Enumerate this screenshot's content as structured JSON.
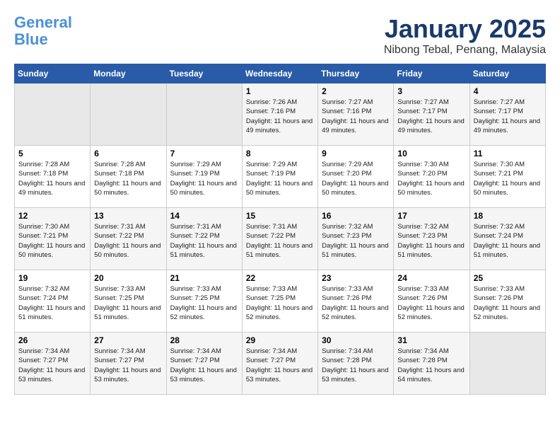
{
  "header": {
    "logo_line1": "General",
    "logo_line2": "Blue",
    "title": "January 2025",
    "location": "Nibong Tebal, Penang, Malaysia"
  },
  "days_of_week": [
    "Sunday",
    "Monday",
    "Tuesday",
    "Wednesday",
    "Thursday",
    "Friday",
    "Saturday"
  ],
  "weeks": [
    [
      {
        "day": "",
        "sunrise": "",
        "sunset": "",
        "daylight": "",
        "empty": true
      },
      {
        "day": "",
        "sunrise": "",
        "sunset": "",
        "daylight": "",
        "empty": true
      },
      {
        "day": "",
        "sunrise": "",
        "sunset": "",
        "daylight": "",
        "empty": true
      },
      {
        "day": "1",
        "sunrise": "Sunrise: 7:26 AM",
        "sunset": "Sunset: 7:16 PM",
        "daylight": "Daylight: 11 hours and 49 minutes.",
        "empty": false
      },
      {
        "day": "2",
        "sunrise": "Sunrise: 7:27 AM",
        "sunset": "Sunset: 7:16 PM",
        "daylight": "Daylight: 11 hours and 49 minutes.",
        "empty": false
      },
      {
        "day": "3",
        "sunrise": "Sunrise: 7:27 AM",
        "sunset": "Sunset: 7:17 PM",
        "daylight": "Daylight: 11 hours and 49 minutes.",
        "empty": false
      },
      {
        "day": "4",
        "sunrise": "Sunrise: 7:27 AM",
        "sunset": "Sunset: 7:17 PM",
        "daylight": "Daylight: 11 hours and 49 minutes.",
        "empty": false
      }
    ],
    [
      {
        "day": "5",
        "sunrise": "Sunrise: 7:28 AM",
        "sunset": "Sunset: 7:18 PM",
        "daylight": "Daylight: 11 hours and 49 minutes.",
        "empty": false
      },
      {
        "day": "6",
        "sunrise": "Sunrise: 7:28 AM",
        "sunset": "Sunset: 7:18 PM",
        "daylight": "Daylight: 11 hours and 50 minutes.",
        "empty": false
      },
      {
        "day": "7",
        "sunrise": "Sunrise: 7:29 AM",
        "sunset": "Sunset: 7:19 PM",
        "daylight": "Daylight: 11 hours and 50 minutes.",
        "empty": false
      },
      {
        "day": "8",
        "sunrise": "Sunrise: 7:29 AM",
        "sunset": "Sunset: 7:19 PM",
        "daylight": "Daylight: 11 hours and 50 minutes.",
        "empty": false
      },
      {
        "day": "9",
        "sunrise": "Sunrise: 7:29 AM",
        "sunset": "Sunset: 7:20 PM",
        "daylight": "Daylight: 11 hours and 50 minutes.",
        "empty": false
      },
      {
        "day": "10",
        "sunrise": "Sunrise: 7:30 AM",
        "sunset": "Sunset: 7:20 PM",
        "daylight": "Daylight: 11 hours and 50 minutes.",
        "empty": false
      },
      {
        "day": "11",
        "sunrise": "Sunrise: 7:30 AM",
        "sunset": "Sunset: 7:21 PM",
        "daylight": "Daylight: 11 hours and 50 minutes.",
        "empty": false
      }
    ],
    [
      {
        "day": "12",
        "sunrise": "Sunrise: 7:30 AM",
        "sunset": "Sunset: 7:21 PM",
        "daylight": "Daylight: 11 hours and 50 minutes.",
        "empty": false
      },
      {
        "day": "13",
        "sunrise": "Sunrise: 7:31 AM",
        "sunset": "Sunset: 7:22 PM",
        "daylight": "Daylight: 11 hours and 50 minutes.",
        "empty": false
      },
      {
        "day": "14",
        "sunrise": "Sunrise: 7:31 AM",
        "sunset": "Sunset: 7:22 PM",
        "daylight": "Daylight: 11 hours and 51 minutes.",
        "empty": false
      },
      {
        "day": "15",
        "sunrise": "Sunrise: 7:31 AM",
        "sunset": "Sunset: 7:22 PM",
        "daylight": "Daylight: 11 hours and 51 minutes.",
        "empty": false
      },
      {
        "day": "16",
        "sunrise": "Sunrise: 7:32 AM",
        "sunset": "Sunset: 7:23 PM",
        "daylight": "Daylight: 11 hours and 51 minutes.",
        "empty": false
      },
      {
        "day": "17",
        "sunrise": "Sunrise: 7:32 AM",
        "sunset": "Sunset: 7:23 PM",
        "daylight": "Daylight: 11 hours and 51 minutes.",
        "empty": false
      },
      {
        "day": "18",
        "sunrise": "Sunrise: 7:32 AM",
        "sunset": "Sunset: 7:24 PM",
        "daylight": "Daylight: 11 hours and 51 minutes.",
        "empty": false
      }
    ],
    [
      {
        "day": "19",
        "sunrise": "Sunrise: 7:32 AM",
        "sunset": "Sunset: 7:24 PM",
        "daylight": "Daylight: 11 hours and 51 minutes.",
        "empty": false
      },
      {
        "day": "20",
        "sunrise": "Sunrise: 7:33 AM",
        "sunset": "Sunset: 7:25 PM",
        "daylight": "Daylight: 11 hours and 51 minutes.",
        "empty": false
      },
      {
        "day": "21",
        "sunrise": "Sunrise: 7:33 AM",
        "sunset": "Sunset: 7:25 PM",
        "daylight": "Daylight: 11 hours and 52 minutes.",
        "empty": false
      },
      {
        "day": "22",
        "sunrise": "Sunrise: 7:33 AM",
        "sunset": "Sunset: 7:25 PM",
        "daylight": "Daylight: 11 hours and 52 minutes.",
        "empty": false
      },
      {
        "day": "23",
        "sunrise": "Sunrise: 7:33 AM",
        "sunset": "Sunset: 7:26 PM",
        "daylight": "Daylight: 11 hours and 52 minutes.",
        "empty": false
      },
      {
        "day": "24",
        "sunrise": "Sunrise: 7:33 AM",
        "sunset": "Sunset: 7:26 PM",
        "daylight": "Daylight: 11 hours and 52 minutes.",
        "empty": false
      },
      {
        "day": "25",
        "sunrise": "Sunrise: 7:33 AM",
        "sunset": "Sunset: 7:26 PM",
        "daylight": "Daylight: 11 hours and 52 minutes.",
        "empty": false
      }
    ],
    [
      {
        "day": "26",
        "sunrise": "Sunrise: 7:34 AM",
        "sunset": "Sunset: 7:27 PM",
        "daylight": "Daylight: 11 hours and 53 minutes.",
        "empty": false
      },
      {
        "day": "27",
        "sunrise": "Sunrise: 7:34 AM",
        "sunset": "Sunset: 7:27 PM",
        "daylight": "Daylight: 11 hours and 53 minutes.",
        "empty": false
      },
      {
        "day": "28",
        "sunrise": "Sunrise: 7:34 AM",
        "sunset": "Sunset: 7:27 PM",
        "daylight": "Daylight: 11 hours and 53 minutes.",
        "empty": false
      },
      {
        "day": "29",
        "sunrise": "Sunrise: 7:34 AM",
        "sunset": "Sunset: 7:27 PM",
        "daylight": "Daylight: 11 hours and 53 minutes.",
        "empty": false
      },
      {
        "day": "30",
        "sunrise": "Sunrise: 7:34 AM",
        "sunset": "Sunset: 7:28 PM",
        "daylight": "Daylight: 11 hours and 53 minutes.",
        "empty": false
      },
      {
        "day": "31",
        "sunrise": "Sunrise: 7:34 AM",
        "sunset": "Sunset: 7:28 PM",
        "daylight": "Daylight: 11 hours and 54 minutes.",
        "empty": false
      },
      {
        "day": "",
        "sunrise": "",
        "sunset": "",
        "daylight": "",
        "empty": true
      }
    ]
  ]
}
